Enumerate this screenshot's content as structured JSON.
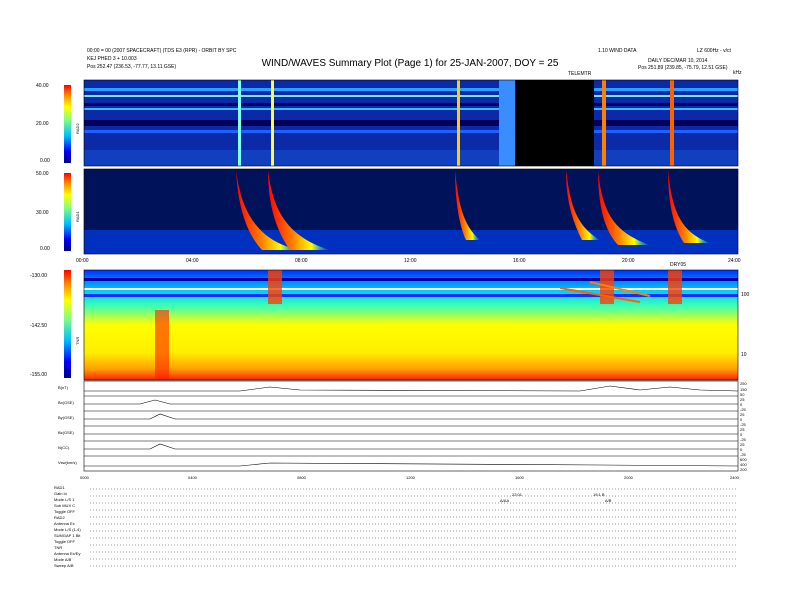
{
  "header": {
    "title": "WIND/WAVES Summary Plot (Page 1) for 25-JAN-2007, DOY = 25",
    "left_line1": "00:00 = 00 (2007 SPACECRAFT) (TDS E3 (RPR) - ORBIT BY SPC",
    "left_line2": "KEJ PHED 3 + 10.003",
    "left_line3": "Pos   252.47 (236.53, -77.77, 13.11 GSE)",
    "right_line1": "1.10 WIND DATA",
    "right_line2": "LZ 600Hz - v/ct",
    "right_line3": "DAILY  DEC/MAR 10, 2014",
    "right_line4": "Pos   251.89 (239.85, -75.79, 12.51 GSE)",
    "telemetry_label": "TELEMTR",
    "khz_label": "kHz"
  },
  "panels": {
    "rad2": {
      "label": "RAD2",
      "ticks": [
        "40.00",
        "20.00",
        "0.00"
      ]
    },
    "rad1": {
      "label": "RAD1",
      "ticks": [
        "50.00",
        "30.00",
        "0.00"
      ]
    },
    "tnr": {
      "label": "TNR",
      "ticks": [
        "-130.00",
        "-142.50",
        "-155.00"
      ],
      "right_ticks": [
        "100",
        "10"
      ]
    }
  },
  "time_axis": {
    "ticks": [
      "00:00",
      "04:00",
      "08:00",
      "12:00",
      "16:00",
      "20:00",
      "24:00"
    ],
    "extra_label": "DRY05"
  },
  "line_panels": [
    {
      "label": "B(nT)",
      "rticks": [
        "250",
        "150",
        "50"
      ]
    },
    {
      "label": "Bx(GSE)",
      "rticks": [
        "25",
        "0",
        "-25"
      ]
    },
    {
      "label": "By(GSE)",
      "rticks": [
        "25",
        "0",
        "-25"
      ]
    },
    {
      "label": "Bz(GSE)",
      "rticks": [
        "25",
        "0",
        "-25"
      ]
    },
    {
      "label": "N(CC)",
      "rticks": [
        "25",
        "0",
        "-25"
      ]
    },
    {
      "label": "Vsw(km/s)",
      "rticks": [
        "600",
        "400",
        "200"
      ]
    }
  ],
  "bottom_axis": {
    "ticks": [
      "0000",
      "0400",
      "0800",
      "1200",
      "1600",
      "2000",
      "2400"
    ]
  },
  "info": {
    "rows": [
      "RAD1",
      "Gain   In",
      "Mode   L/S 1",
      "Sub    MUX C",
      "Toggle   OFF",
      "RAD2",
      "Antenna   Ex",
      "Mode   L/S (1-4)",
      "SUMGAP 1 Bit",
      "Toggle   OFF",
      "TNR",
      "Antenna   Ex/Ey",
      "Mode   A/B",
      "Sweep   A/B"
    ],
    "mid_notes": [
      "22:01",
      "19:1 B",
      "A/AA",
      "A/B"
    ]
  }
}
